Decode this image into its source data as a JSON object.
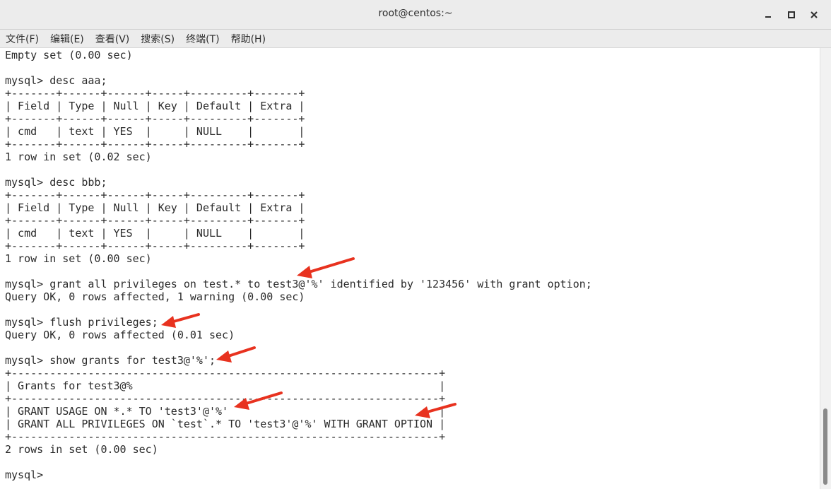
{
  "window": {
    "title": "root@centos:~"
  },
  "menu": [
    {
      "label": "文件(F)"
    },
    {
      "label": "编辑(E)"
    },
    {
      "label": "查看(V)"
    },
    {
      "label": "搜索(S)"
    },
    {
      "label": "终端(T)"
    },
    {
      "label": "帮助(H)"
    }
  ],
  "terminal": {
    "lines": [
      "Empty set (0.00 sec)",
      "",
      "mysql> desc aaa;",
      "+-------+------+------+-----+---------+-------+",
      "| Field | Type | Null | Key | Default | Extra |",
      "+-------+------+------+-----+---------+-------+",
      "| cmd   | text | YES  |     | NULL    |       |",
      "+-------+------+------+-----+---------+-------+",
      "1 row in set (0.02 sec)",
      "",
      "mysql> desc bbb;",
      "+-------+------+------+-----+---------+-------+",
      "| Field | Type | Null | Key | Default | Extra |",
      "+-------+------+------+-----+---------+-------+",
      "| cmd   | text | YES  |     | NULL    |       |",
      "+-------+------+------+-----+---------+-------+",
      "1 row in set (0.00 sec)",
      "",
      "mysql> grant all privileges on test.* to test3@'%' identified by '123456' with grant option;",
      "Query OK, 0 rows affected, 1 warning (0.00 sec)",
      "",
      "mysql> flush privileges;",
      "Query OK, 0 rows affected (0.01 sec)",
      "",
      "mysql> show grants for test3@'%';",
      "+-------------------------------------------------------------------+",
      "| Grants for test3@%                                                |",
      "+-------------------------------------------------------------------+",
      "| GRANT USAGE ON *.* TO 'test3'@'%'                                 |",
      "| GRANT ALL PRIVILEGES ON `test`.* TO 'test3'@'%' WITH GRANT OPTION |",
      "+-------------------------------------------------------------------+",
      "2 rows in set (0.00 sec)",
      "",
      "mysql> "
    ]
  },
  "colors": {
    "annotation_arrow": "#e8321f"
  }
}
